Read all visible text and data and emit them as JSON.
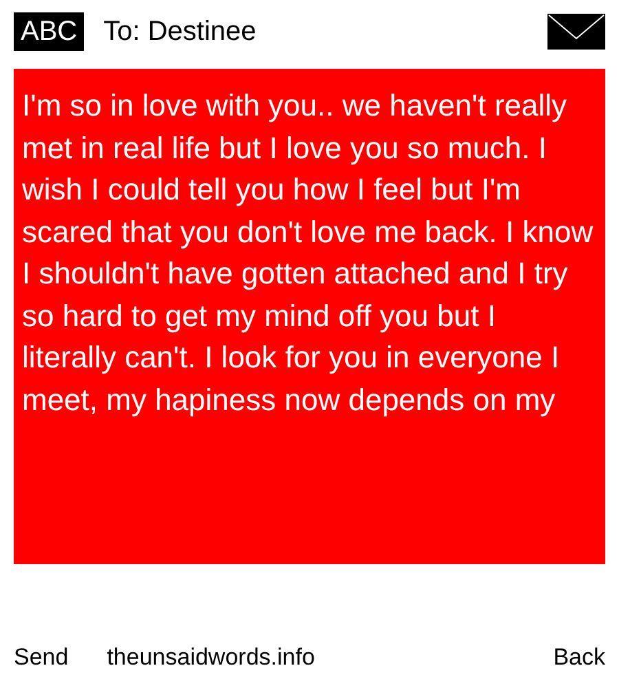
{
  "header": {
    "input_mode": "ABC",
    "recipient": "To: Destinee"
  },
  "message": {
    "text": "I'm so in love with you.. we haven't really met in real life but I love you so much. I wish I could tell you how I feel but I'm scared that you don't love me back. I know I shouldn't have gotten attached and I try so hard to get my mind off you but I literally can't. I look for you in everyone I meet, my hapiness now depends on my"
  },
  "softkeys": {
    "left": "Send",
    "center": "theunsaidwords.info",
    "right": "Back"
  }
}
